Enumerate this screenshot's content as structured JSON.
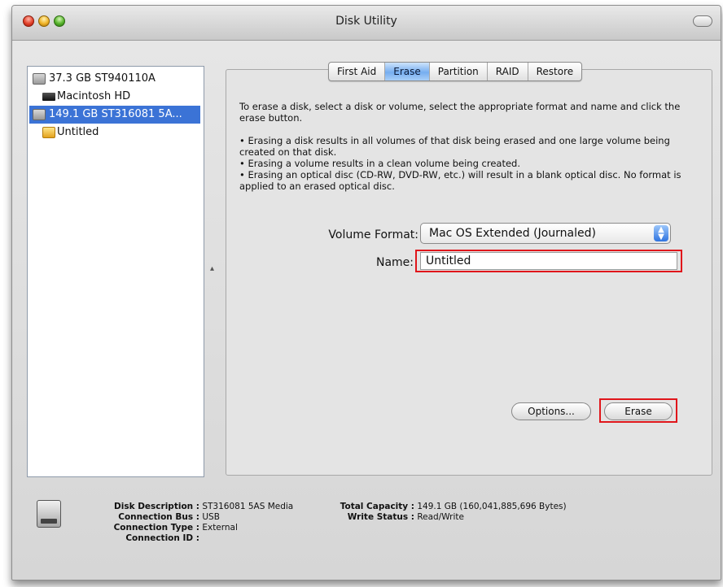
{
  "window": {
    "title": "Disk Utility"
  },
  "sidebar": {
    "items": [
      {
        "label": "37.3 GB ST940110A",
        "icon": "hard-disk-icon"
      },
      {
        "label": "Macintosh HD",
        "icon": "volume-icon"
      },
      {
        "label": "149.1 GB ST316081 5A...",
        "icon": "hard-disk-icon",
        "selected": true
      },
      {
        "label": "Untitled",
        "icon": "external-volume-icon"
      }
    ]
  },
  "tabs": [
    "First Aid",
    "Erase",
    "Partition",
    "RAID",
    "Restore"
  ],
  "active_tab": "Erase",
  "erase": {
    "intro": "To erase a disk, select a disk or volume, select the appropriate format and name and click the erase button.",
    "bullets": [
      "• Erasing a disk results in all volumes of that disk being erased and one large volume being created on that disk.",
      "• Erasing a volume results in a clean volume being created.",
      "• Erasing an optical disc (CD-RW, DVD-RW, etc.) will result in a blank optical disc.  No format is applied to an erased optical disc."
    ],
    "volume_format_label": "Volume Format:",
    "volume_format_value": "Mac OS Extended (Journaled)",
    "name_label": "Name:",
    "name_value": "Untitled",
    "options_button": "Options...",
    "erase_button": "Erase"
  },
  "info": {
    "left": [
      {
        "key": "Disk Description :",
        "value": "ST316081 5AS Media"
      },
      {
        "key": "Connection Bus :",
        "value": "USB"
      },
      {
        "key": "Connection Type :",
        "value": "External"
      },
      {
        "key": "Connection ID :",
        "value": ""
      }
    ],
    "right": [
      {
        "key": "Total Capacity :",
        "value": "149.1 GB (160,041,885,696 Bytes)"
      },
      {
        "key": "Write Status :",
        "value": "Read/Write"
      }
    ]
  },
  "colors": {
    "selection": "#3b73d6",
    "highlight_box": "#e0161b",
    "active_tab": "#76aef0"
  }
}
